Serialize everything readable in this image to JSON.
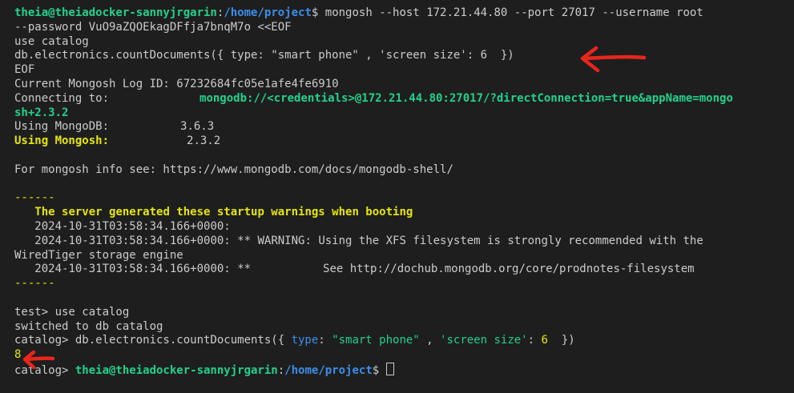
{
  "terminal": {
    "prompt_user": "theia@theiadocker-sannyjrgarin",
    "prompt_path": "/home/project",
    "prompt_symbol": "$",
    "command_1": "mongosh --host 172.21.44.80 --port 27017 --username root",
    "command_2": "--password VuO9aZQOEkagDFfja7bnqM7o <<EOF",
    "heredoc_use": "use catalog",
    "heredoc_query": "db.electronics.countDocuments({ type: \"smart phone\" , 'screen size': 6  })",
    "heredoc_end": "EOF",
    "log_id_line": "Current Mongosh Log ID: 67232684fc05e1afe4fe6910",
    "connecting_label": "Connecting to:",
    "connecting_value": "mongodb://<credentials>@172.21.44.80:27017/?directConnection=true&appName=mongo",
    "connecting_cont": "sh+2.3.2",
    "mongodb_label": "Using MongoDB:",
    "mongodb_version": "3.6.3",
    "mongosh_label": "Using Mongosh:",
    "mongosh_version": "2.3.2",
    "info_line": "For mongosh info see: https://www.mongodb.com/docs/mongodb-shell/",
    "separator": "------",
    "warnings_title": "The server generated these startup warnings when booting",
    "warning_1": "2024-10-31T03:58:34.166+0000:",
    "warning_2_ts": "2024-10-31T03:58:34.166+0000:",
    "warning_2_text": "** WARNING: Using the XFS filesystem is strongly recommended with the",
    "warning_2_cont": "WiredTiger storage engine",
    "warning_3_ts": "2024-10-31T03:58:34.166+0000: **",
    "warning_3_text": "See http://dochub.mongodb.org/core/prodnotes-filesystem",
    "test_prompt": "test> use catalog",
    "switched_line": "switched to db catalog",
    "catalog_prompt": "catalog> ",
    "query_prefix": "db.electronics.countDocuments({ ",
    "query_key_type": "type",
    "query_colon_1": ": ",
    "query_string": "\"smart phone\"",
    "query_comma": " , ",
    "query_key_screen": "'screen size'",
    "query_colon_2": ": ",
    "query_number": "6",
    "query_end": "  })",
    "result": "8",
    "final_catalog_prompt": "catalog> "
  },
  "colors": {
    "background": "#1e1e1e",
    "foreground": "#cccccc",
    "green": "#23d18b",
    "blue": "#3b8eea",
    "yellow": "#e5e510",
    "annotation_red": "#e8261c"
  }
}
